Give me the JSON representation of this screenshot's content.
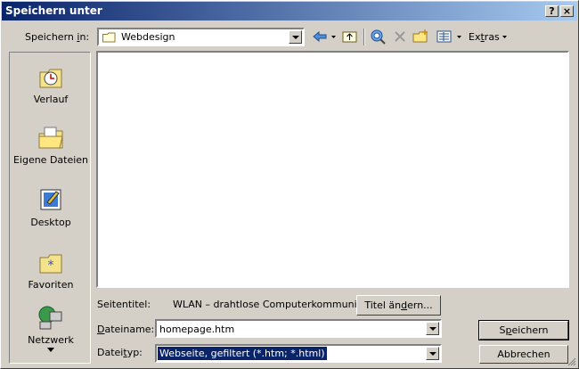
{
  "dialog": {
    "title": "Speichern unter"
  },
  "titlebar_buttons": {
    "help": "?",
    "close": "×"
  },
  "location": {
    "label_pre": "Speichern ",
    "label_acc": "i",
    "label_post": "n:",
    "value": "Webdesign"
  },
  "toolbar": {
    "extras_acc": "t",
    "extras_pre": "Ex",
    "extras_post": "ras"
  },
  "places": [
    {
      "label": "Verlauf",
      "icon": "history-icon"
    },
    {
      "label": "Eigene Dateien",
      "icon": "my-documents-icon"
    },
    {
      "label": "Desktop",
      "icon": "desktop-icon"
    },
    {
      "label": "Favoriten",
      "icon": "favorites-icon"
    },
    {
      "label": "Netzwerk",
      "icon": "network-icon"
    }
  ],
  "page_title": {
    "label": "Seitentitel:",
    "value": "WLAN – drahtlose Computerkommuni...",
    "button_pre": "Titel än",
    "button_acc": "d",
    "button_post": "ern..."
  },
  "filename": {
    "label_acc": "D",
    "label_rest": "ateiname:",
    "value": "homepage.htm"
  },
  "filetype": {
    "label_pre": "Datei",
    "label_acc": "t",
    "label_post": "yp:",
    "value": "Webseite, gefiltert (*.htm; *.html)"
  },
  "buttons": {
    "save_pre": "S",
    "save_acc": "p",
    "save_post": "eichern",
    "cancel": "Abbrechen"
  }
}
